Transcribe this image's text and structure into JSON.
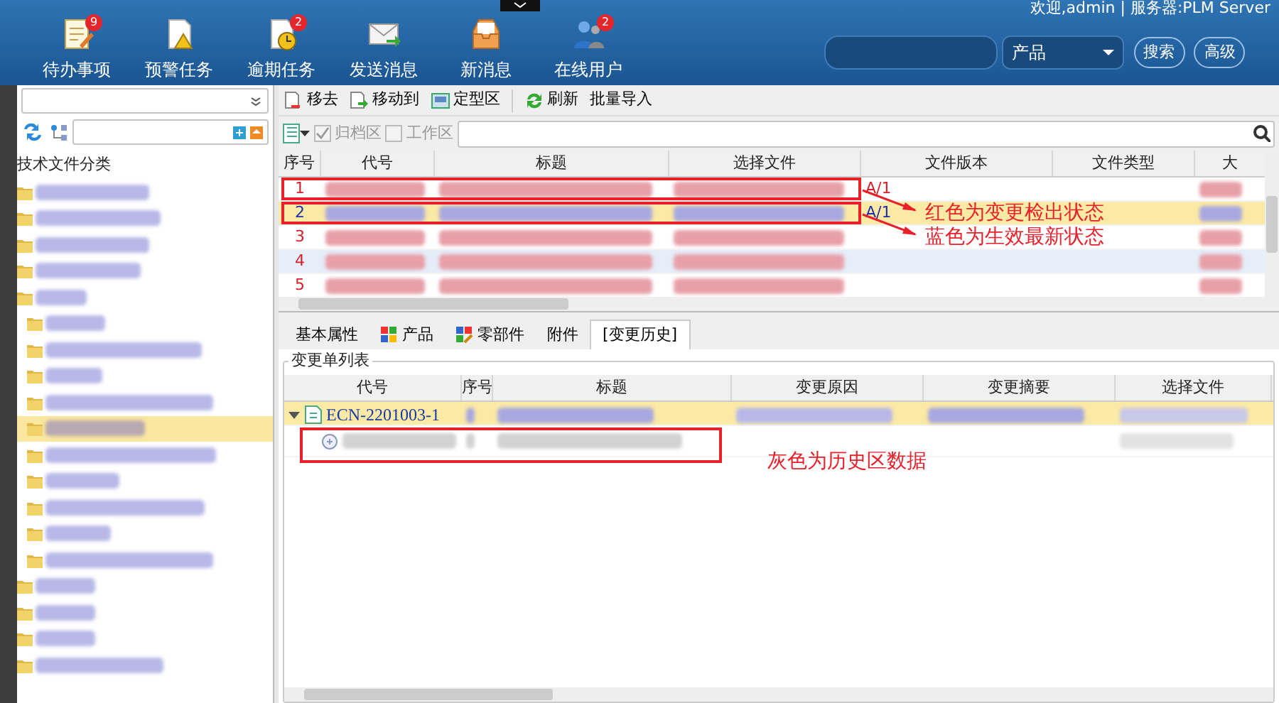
{
  "header": {
    "welcome": "欢迎,admin | 服务器:PLM Server",
    "tools": [
      {
        "label": "待办事项",
        "badge": "9",
        "kind": "todo"
      },
      {
        "label": "预警任务",
        "kind": "warning"
      },
      {
        "label": "逾期任务",
        "badge": "2",
        "kind": "overdue"
      },
      {
        "label": "发送消息",
        "kind": "send"
      },
      {
        "label": "新消息",
        "kind": "inbox"
      },
      {
        "label": "在线用户",
        "badge": "2",
        "kind": "users"
      }
    ],
    "search": {
      "category": "产品",
      "buttons": [
        "搜索",
        "高级"
      ]
    }
  },
  "tree": {
    "title": "技术文件分类",
    "items": [
      {
        "selected": false
      },
      {
        "selected": false
      },
      {
        "selected": false
      },
      {
        "selected": false
      },
      {
        "selected": false,
        "children": [
          {
            "selected": false
          },
          {
            "selected": false
          },
          {
            "selected": false
          },
          {
            "selected": false
          },
          {
            "selected": true
          },
          {
            "selected": false
          },
          {
            "selected": false
          },
          {
            "selected": false
          },
          {
            "selected": false
          },
          {
            "selected": false
          }
        ]
      },
      {
        "selected": false
      },
      {
        "selected": false
      },
      {
        "selected": false
      },
      {
        "selected": false
      }
    ]
  },
  "toolbar": [
    {
      "label": "移去",
      "kind": "remove"
    },
    {
      "label": "移动到",
      "kind": "move"
    },
    {
      "label": "定型区",
      "kind": "final"
    },
    {
      "label": "刷新",
      "kind": "refresh"
    },
    {
      "label": "批量导入",
      "kind": "import"
    }
  ],
  "filters": [
    {
      "label": "归档区",
      "checked": true,
      "disabled": true
    },
    {
      "label": "工作区",
      "checked": false,
      "disabled": true
    }
  ],
  "documents": {
    "columns": [
      "序号",
      "代号",
      "标题",
      "选择文件",
      "文件版本",
      "文件类型",
      "大"
    ],
    "rows": [
      {
        "number": "1",
        "kind": "checkedout",
        "version": "A/1",
        "selected": false
      },
      {
        "number": "2",
        "kind": "released",
        "version": "A/1",
        "selected": true
      },
      {
        "number": "3",
        "kind": "checkedout",
        "selected": false
      },
      {
        "number": "4",
        "kind": "checkedout",
        "selected": false,
        "hovered": true
      },
      {
        "number": "5",
        "kind": "checkedout",
        "selected": false
      }
    ],
    "annotations": [
      "红色为变更检出状态",
      "蓝色为生效最新状态"
    ]
  },
  "tabs": [
    {
      "label": "基本属性",
      "selected": false
    },
    {
      "label": "产品",
      "kind": "product",
      "selected": false
    },
    {
      "label": "零部件",
      "kind": "part",
      "selected": false
    },
    {
      "label": "附件",
      "selected": false
    },
    {
      "label": "[变更历史]",
      "selected": true
    }
  ],
  "changes": {
    "legend": "变更单列表",
    "columns": [
      "代号",
      "序号",
      "标题",
      "变更原因",
      "变更摘要",
      "选择文件"
    ],
    "rows": [
      {
        "code": "ECN-2201003-1",
        "expanded": true,
        "selected": true,
        "children": [
          {
            "kind": "history"
          }
        ]
      }
    ],
    "annotation": "灰色为历史区数据"
  }
}
